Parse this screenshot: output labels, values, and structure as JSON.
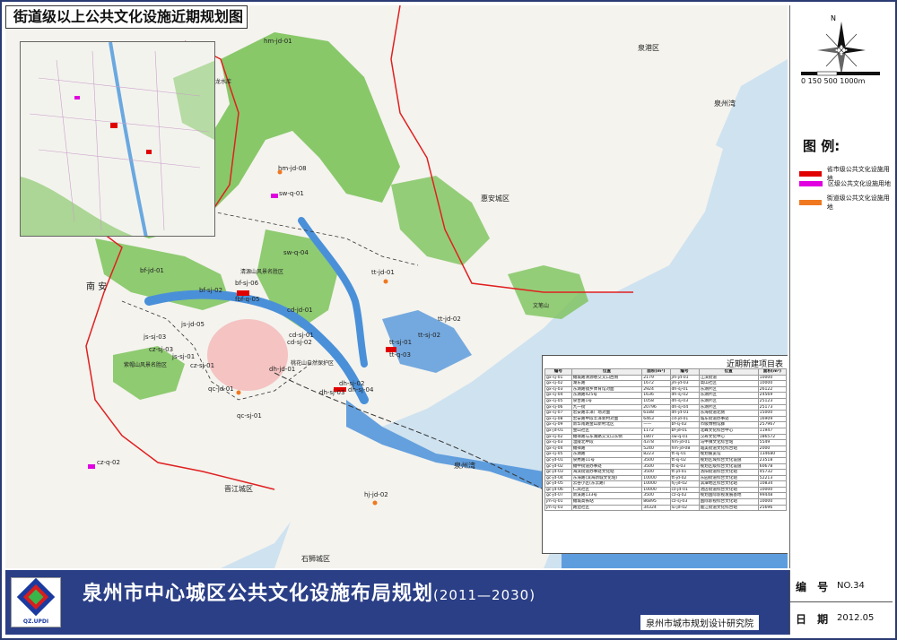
{
  "map_title": "街道级以上公共文化设施近期规划图",
  "main_title": "泉州市中心城区公共文化设施布局规划",
  "main_title_years": "(2011—2030)",
  "organization": "泉州市城市规划设计研究院",
  "logo_text": "QZ.UPDI",
  "meta": {
    "number_label": "编 号",
    "number_value": "NO.34",
    "date_label": "日 期",
    "date_value": "2012.05"
  },
  "north_label": "N",
  "scale_labels": "0  150  500      1000m",
  "legend": {
    "title": "图  例:",
    "items": [
      {
        "label": "省市级公共文化设施用地",
        "color": "#e00000"
      },
      {
        "label": "区级公共文化设施用地",
        "color": "#e000e0"
      },
      {
        "label": "街道级公共文化设施用地",
        "color": "#f07820"
      }
    ]
  },
  "place_labels": [
    "泉港区",
    "泉州湾",
    "惠安城区",
    "南  安",
    "晋江城区",
    "石狮城区",
    "泉州湾",
    "文笔山",
    "清源山风景名胜区",
    "紫帽山风景名胜区",
    "桃花山自然保护区",
    "青龙水库"
  ],
  "site_labels": [
    "hm-jd-01",
    "hm-jd-08",
    "sw-q-01",
    "sw-q-04",
    "bf-jd-01",
    "tt-jd-01",
    "bf-sj-06",
    "fbf-q-05",
    "bf-sj-02",
    "cd-jd-01",
    "cd-sj-01",
    "cd-sj-02",
    "js-jd-05",
    "js-sj-03",
    "tt-jd-02",
    "tt-sj-01",
    "tt-sj-02",
    "tt-q-03",
    "cz-sj-03",
    "js-sj-01",
    "cz-sj-01",
    "dh-jd-01",
    "dh-sj-02",
    "dh-sj-04",
    "dh-sj-03",
    "qc-jd-01",
    "qc-sj-01",
    "cz-q-02",
    "hj-jd-02"
  ],
  "project_table": {
    "title": "近期新建项目表",
    "headers": [
      "编号",
      "位置",
      "面积(m²)",
      "编号",
      "位置",
      "面积(m²)"
    ],
    "rows": [
      [
        "gx-sj-01",
        "鲤城路清源巷交叉口西侧",
        "2179",
        "jm-jd-01",
        "江滨街道",
        "10000"
      ],
      [
        "gx-sj-02",
        "湖东路",
        "1672",
        "jm-jd-03",
        "高山社区",
        "10000"
      ],
      [
        "gx-sj-03",
        "东湖路镜乡体育馆对面",
        "2924",
        "dh-sj-01",
        "东湖片区",
        "26122"
      ],
      [
        "gx-sj-04",
        "东湖路425号",
        "1636",
        "dh-sj-02",
        "东湖片区",
        "24569"
      ],
      [
        "gx-sj-05",
        "泉台路1号",
        "1058",
        "dh-sj-03",
        "东湖片区",
        "25123"
      ],
      [
        "gx-sj-06",
        "九一街",
        "20796",
        "dh-sj-04",
        "东湖片区",
        "25173"
      ],
      [
        "gx-sj-07",
        "宏安路丰泽广场对面",
        "6188",
        "dh-jd-01",
        "东海街道北侧",
        "15000"
      ],
      [
        "gx-sj-08",
        "宏安路中段丰泽新村对面",
        "6463",
        "cd-jd-01",
        "城东街道办事处",
        "16909"
      ],
      [
        "gx-sj-09",
        "新华南路金山新村北区",
        "——",
        "bf-sj-02",
        "市级博物馆群",
        "257967"
      ],
      [
        "gx-jd-01",
        "金山社区",
        "1172",
        "bf-jd-01",
        "北峰文化综合中心",
        "11947"
      ],
      [
        "gx-sj-02",
        "鲤祥路与东湖路交叉口东侧",
        "1807",
        "sw-q-01",
        "汉寿文化中心",
        "186572"
      ],
      [
        "gx-sj-03",
        "温陵北中段",
        "4378",
        "hm-jd-01",
        "马甲镇文化综合站",
        "5549"
      ],
      [
        "gx-sj-04",
        "鲤祥路",
        "5240",
        "hm-jd-08",
        "霞美街道文化综合站",
        "2000"
      ],
      [
        "gx-sj-05",
        "东湖路",
        "8223",
        "tt-sj-01",
        "规划展览馆",
        "134680"
      ],
      [
        "gc-jd-01",
        "泉秀路11号",
        "3500",
        "tt-sj-02",
        "规划区域综合文化设施",
        "23518"
      ],
      [
        "gc-jd-02",
        "鲤中街道办事处",
        "3500",
        "tt-q-03",
        "规划区级综合文化设施",
        "60678"
      ],
      [
        "gc-jd-03",
        "海滨街道办事处文化站",
        "3500",
        "tt-jd-01",
        "洛阳街道综合文化站",
        "45732"
      ],
      [
        "gc-jd-04",
        "东海路(滨海新城文化站)",
        "10000",
        "tt-jd-02",
        "东园街道综合文化站",
        "52213"
      ],
      [
        "gc-jd-05",
        "云谷小区(东云路)",
        "10000",
        "hj-jd-02",
        "滨潭地区综合文化站",
        "10834"
      ],
      [
        "gc-jd-06",
        "仁凤社区",
        "10000",
        "cz-jd-01",
        "池店街道综合文化站",
        "10000"
      ],
      [
        "gc-jd-07",
        "新溪路133号",
        "3500",
        "cz-q-02",
        "规划国际影视发展基地",
        "99448"
      ],
      [
        "jm-sj-01",
        "鲤城高铁站",
        "86895",
        "cz-sj-03",
        "国际影视综合文化站",
        "10000"
      ],
      [
        "jm-sj-03",
        "路边社区",
        "34324",
        "lu-jd-02",
        "鹿江街道文化综合站",
        "25696"
      ]
    ]
  }
}
